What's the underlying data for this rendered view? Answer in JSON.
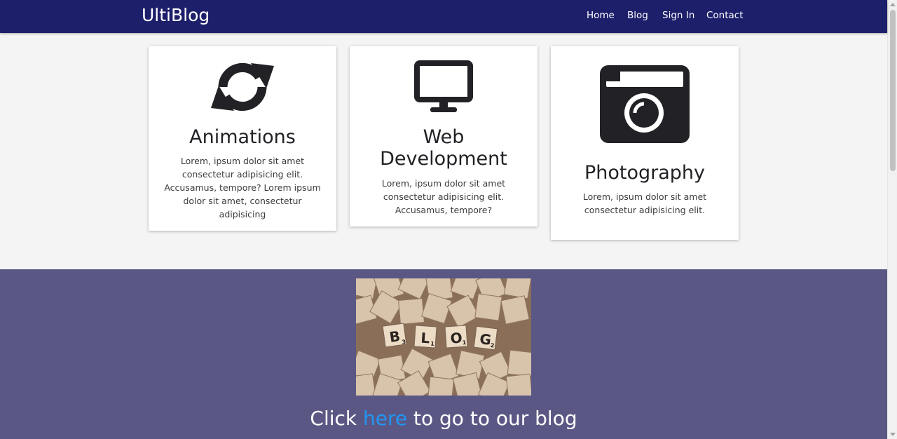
{
  "navbar": {
    "brand": "UltiBlog",
    "links": [
      "Home",
      "Blog",
      "Sign In",
      "Contact"
    ]
  },
  "cards": [
    {
      "icon": "sync-icon",
      "title": "Animations",
      "text": "Lorem, ipsum dolor sit amet consectetur adipisicing elit. Accusamus, tempore? Lorem ipsum dolor sit amet, consectetur adipisicing"
    },
    {
      "icon": "desktop-icon",
      "title": "Web Development",
      "text": "Lorem, ipsum dolor sit amet consectetur adipisicing elit. Accusamus, tempore?"
    },
    {
      "icon": "camera-icon",
      "title": "Photography",
      "text": "Lorem, ipsum dolor sit amet consectetur adipisicing elit."
    }
  ],
  "blog_banner": {
    "tiles": [
      "B",
      "L",
      "O",
      "G"
    ],
    "tile_scores": [
      "3",
      "1",
      "1",
      "2"
    ],
    "cta_prefix": "Click ",
    "cta_link": "here",
    "cta_suffix": " to go to our blog"
  },
  "colors": {
    "navbar_bg": "#1d1f6b",
    "page_bg": "#f4f4f4",
    "blog_section_bg": "#5a5784",
    "link": "#2196f3",
    "icon": "#222226"
  }
}
